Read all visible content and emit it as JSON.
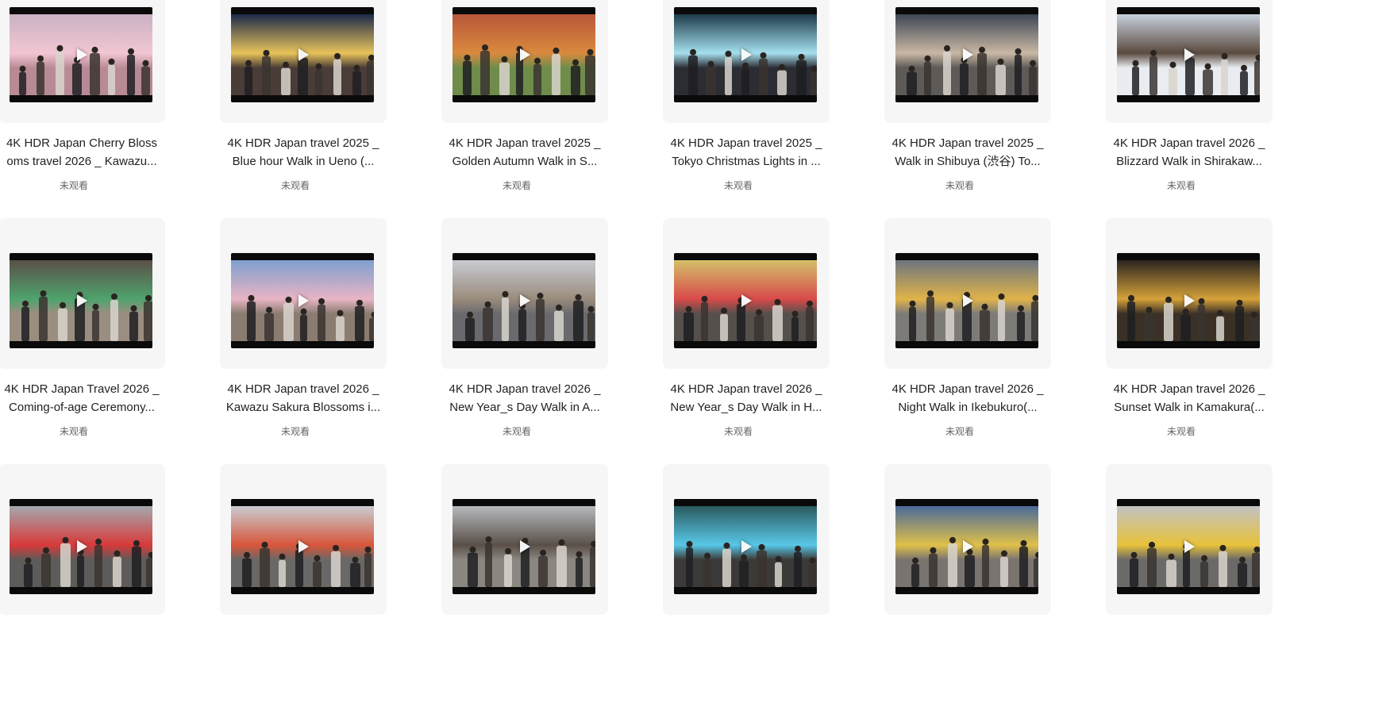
{
  "videos": [
    {
      "title1": "4K HDR Japan Cherry Bloss",
      "title2": "oms travel 2026 _ Kawazu...",
      "status": "未观看",
      "sky": "#c9b2c4",
      "ground": "#b88a95",
      "accent": "#f2c6d3"
    },
    {
      "title1": "4K HDR Japan travel 2025 _",
      "title2": "Blue hour Walk in Ueno (...",
      "status": "未观看",
      "sky": "#1c2a4a",
      "ground": "#4a3c36",
      "accent": "#e8c35a"
    },
    {
      "title1": "4K HDR Japan travel 2025 _",
      "title2": "Golden Autumn Walk in S...",
      "status": "未观看",
      "sky": "#b8573a",
      "ground": "#6f8c4a",
      "accent": "#d98a3e"
    },
    {
      "title1": "4K HDR Japan travel 2025 _",
      "title2": "Tokyo Christmas Lights in ...",
      "status": "未观看",
      "sky": "#1d3b4a",
      "ground": "#2b2d33",
      "accent": "#a6e0ee"
    },
    {
      "title1": "4K HDR Japan travel 2025 _",
      "title2": "Walk in Shibuya (渋谷) To...",
      "status": "未观看",
      "sky": "#3d4654",
      "ground": "#5d5a58",
      "accent": "#c9b8a4"
    },
    {
      "title1": "4K HDR Japan travel 2026 _",
      "title2": "Blizzard Walk in Shirakaw...",
      "status": "未观看",
      "sky": "#c7d1de",
      "ground": "#e9edf2",
      "accent": "#5a4a3e"
    },
    {
      "title1": "4K HDR Japan Travel 2026 _",
      "title2": "Coming-of-age Ceremony...",
      "status": "未观看",
      "sky": "#5a5048",
      "ground": "#9a8e80",
      "accent": "#4fa36c"
    },
    {
      "title1": "4K HDR Japan travel 2026 _",
      "title2": "Kawazu Sakura Blossoms i...",
      "status": "未观看",
      "sky": "#7f9fd0",
      "ground": "#8a7c70",
      "accent": "#e8b4c4"
    },
    {
      "title1": "4K HDR Japan travel 2026 _",
      "title2": "New Year_s Day Walk in A...",
      "status": "未观看",
      "sky": "#c8cbd2",
      "ground": "#6a6a6e",
      "accent": "#9a8c7c"
    },
    {
      "title1": "4K HDR Japan travel 2026 _",
      "title2": "New Year_s Day Walk in H...",
      "status": "未观看",
      "sky": "#d4c06a",
      "ground": "#55504c",
      "accent": "#d84a4a"
    },
    {
      "title1": "4K HDR Japan travel 2026 _",
      "title2": "Night Walk in Ikebukuro(...",
      "status": "未观看",
      "sky": "#6c7480",
      "ground": "#7d7b78",
      "accent": "#e0b34a"
    },
    {
      "title1": "4K HDR Japan travel 2026 _",
      "title2": "Sunset Walk in Kamakura(...",
      "status": "未观看",
      "sky": "#2a241e",
      "ground": "#3a3026",
      "accent": "#d6a23a"
    },
    {
      "title1": "",
      "title2": "",
      "status": "",
      "sky": "#a4a8ae",
      "ground": "#5e5c5a",
      "accent": "#d83a3a"
    },
    {
      "title1": "",
      "title2": "",
      "status": "",
      "sky": "#c8ccd2",
      "ground": "#6a6866",
      "accent": "#d8563a"
    },
    {
      "title1": "",
      "title2": "",
      "status": "",
      "sky": "#b6b9be",
      "ground": "#8a8680",
      "accent": "#5a5048"
    },
    {
      "title1": "",
      "title2": "",
      "status": "",
      "sky": "#2a5a5e",
      "ground": "#3c3a38",
      "accent": "#58c8e8"
    },
    {
      "title1": "",
      "title2": "",
      "status": "",
      "sky": "#4a6a9a",
      "ground": "#7a7470",
      "accent": "#e0c04a"
    },
    {
      "title1": "",
      "title2": "",
      "status": "",
      "sky": "#c2c2c2",
      "ground": "#6c6a68",
      "accent": "#e8c23a"
    }
  ]
}
